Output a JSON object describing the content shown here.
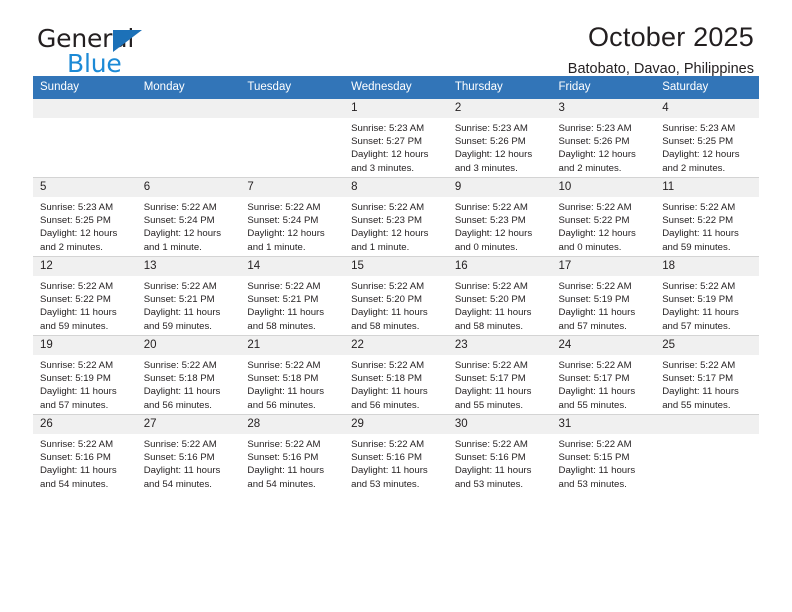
{
  "brand": {
    "name_top": "General",
    "name_bottom": "Blue",
    "triangle_color": "#1c71b8",
    "blue_text_color": "#1c8ad6"
  },
  "header": {
    "title": "October 2025",
    "subtitle": "Batobato, Davao, Philippines",
    "accent_color": "#3275b8",
    "daynum_band_color": "#f0f0f0"
  },
  "weekdays": [
    "Sunday",
    "Monday",
    "Tuesday",
    "Wednesday",
    "Thursday",
    "Friday",
    "Saturday"
  ],
  "labels": {
    "sunrise": "Sunrise:",
    "sunset": "Sunset:",
    "daylight": "Daylight:"
  },
  "weeks": [
    [
      {
        "day": "",
        "empty": true
      },
      {
        "day": "",
        "empty": true
      },
      {
        "day": "",
        "empty": true
      },
      {
        "day": "1",
        "sunrise": "Sunrise: 5:23 AM",
        "sunset": "Sunset: 5:27 PM",
        "daylight1": "Daylight: 12 hours",
        "daylight2": "and 3 minutes."
      },
      {
        "day": "2",
        "sunrise": "Sunrise: 5:23 AM",
        "sunset": "Sunset: 5:26 PM",
        "daylight1": "Daylight: 12 hours",
        "daylight2": "and 3 minutes."
      },
      {
        "day": "3",
        "sunrise": "Sunrise: 5:23 AM",
        "sunset": "Sunset: 5:26 PM",
        "daylight1": "Daylight: 12 hours",
        "daylight2": "and 2 minutes."
      },
      {
        "day": "4",
        "sunrise": "Sunrise: 5:23 AM",
        "sunset": "Sunset: 5:25 PM",
        "daylight1": "Daylight: 12 hours",
        "daylight2": "and 2 minutes."
      }
    ],
    [
      {
        "day": "5",
        "sunrise": "Sunrise: 5:23 AM",
        "sunset": "Sunset: 5:25 PM",
        "daylight1": "Daylight: 12 hours",
        "daylight2": "and 2 minutes."
      },
      {
        "day": "6",
        "sunrise": "Sunrise: 5:22 AM",
        "sunset": "Sunset: 5:24 PM",
        "daylight1": "Daylight: 12 hours",
        "daylight2": "and 1 minute."
      },
      {
        "day": "7",
        "sunrise": "Sunrise: 5:22 AM",
        "sunset": "Sunset: 5:24 PM",
        "daylight1": "Daylight: 12 hours",
        "daylight2": "and 1 minute."
      },
      {
        "day": "8",
        "sunrise": "Sunrise: 5:22 AM",
        "sunset": "Sunset: 5:23 PM",
        "daylight1": "Daylight: 12 hours",
        "daylight2": "and 1 minute."
      },
      {
        "day": "9",
        "sunrise": "Sunrise: 5:22 AM",
        "sunset": "Sunset: 5:23 PM",
        "daylight1": "Daylight: 12 hours",
        "daylight2": "and 0 minutes."
      },
      {
        "day": "10",
        "sunrise": "Sunrise: 5:22 AM",
        "sunset": "Sunset: 5:22 PM",
        "daylight1": "Daylight: 12 hours",
        "daylight2": "and 0 minutes."
      },
      {
        "day": "11",
        "sunrise": "Sunrise: 5:22 AM",
        "sunset": "Sunset: 5:22 PM",
        "daylight1": "Daylight: 11 hours",
        "daylight2": "and 59 minutes."
      }
    ],
    [
      {
        "day": "12",
        "sunrise": "Sunrise: 5:22 AM",
        "sunset": "Sunset: 5:22 PM",
        "daylight1": "Daylight: 11 hours",
        "daylight2": "and 59 minutes."
      },
      {
        "day": "13",
        "sunrise": "Sunrise: 5:22 AM",
        "sunset": "Sunset: 5:21 PM",
        "daylight1": "Daylight: 11 hours",
        "daylight2": "and 59 minutes."
      },
      {
        "day": "14",
        "sunrise": "Sunrise: 5:22 AM",
        "sunset": "Sunset: 5:21 PM",
        "daylight1": "Daylight: 11 hours",
        "daylight2": "and 58 minutes."
      },
      {
        "day": "15",
        "sunrise": "Sunrise: 5:22 AM",
        "sunset": "Sunset: 5:20 PM",
        "daylight1": "Daylight: 11 hours",
        "daylight2": "and 58 minutes."
      },
      {
        "day": "16",
        "sunrise": "Sunrise: 5:22 AM",
        "sunset": "Sunset: 5:20 PM",
        "daylight1": "Daylight: 11 hours",
        "daylight2": "and 58 minutes."
      },
      {
        "day": "17",
        "sunrise": "Sunrise: 5:22 AM",
        "sunset": "Sunset: 5:19 PM",
        "daylight1": "Daylight: 11 hours",
        "daylight2": "and 57 minutes."
      },
      {
        "day": "18",
        "sunrise": "Sunrise: 5:22 AM",
        "sunset": "Sunset: 5:19 PM",
        "daylight1": "Daylight: 11 hours",
        "daylight2": "and 57 minutes."
      }
    ],
    [
      {
        "day": "19",
        "sunrise": "Sunrise: 5:22 AM",
        "sunset": "Sunset: 5:19 PM",
        "daylight1": "Daylight: 11 hours",
        "daylight2": "and 57 minutes."
      },
      {
        "day": "20",
        "sunrise": "Sunrise: 5:22 AM",
        "sunset": "Sunset: 5:18 PM",
        "daylight1": "Daylight: 11 hours",
        "daylight2": "and 56 minutes."
      },
      {
        "day": "21",
        "sunrise": "Sunrise: 5:22 AM",
        "sunset": "Sunset: 5:18 PM",
        "daylight1": "Daylight: 11 hours",
        "daylight2": "and 56 minutes."
      },
      {
        "day": "22",
        "sunrise": "Sunrise: 5:22 AM",
        "sunset": "Sunset: 5:18 PM",
        "daylight1": "Daylight: 11 hours",
        "daylight2": "and 56 minutes."
      },
      {
        "day": "23",
        "sunrise": "Sunrise: 5:22 AM",
        "sunset": "Sunset: 5:17 PM",
        "daylight1": "Daylight: 11 hours",
        "daylight2": "and 55 minutes."
      },
      {
        "day": "24",
        "sunrise": "Sunrise: 5:22 AM",
        "sunset": "Sunset: 5:17 PM",
        "daylight1": "Daylight: 11 hours",
        "daylight2": "and 55 minutes."
      },
      {
        "day": "25",
        "sunrise": "Sunrise: 5:22 AM",
        "sunset": "Sunset: 5:17 PM",
        "daylight1": "Daylight: 11 hours",
        "daylight2": "and 55 minutes."
      }
    ],
    [
      {
        "day": "26",
        "sunrise": "Sunrise: 5:22 AM",
        "sunset": "Sunset: 5:16 PM",
        "daylight1": "Daylight: 11 hours",
        "daylight2": "and 54 minutes."
      },
      {
        "day": "27",
        "sunrise": "Sunrise: 5:22 AM",
        "sunset": "Sunset: 5:16 PM",
        "daylight1": "Daylight: 11 hours",
        "daylight2": "and 54 minutes."
      },
      {
        "day": "28",
        "sunrise": "Sunrise: 5:22 AM",
        "sunset": "Sunset: 5:16 PM",
        "daylight1": "Daylight: 11 hours",
        "daylight2": "and 54 minutes."
      },
      {
        "day": "29",
        "sunrise": "Sunrise: 5:22 AM",
        "sunset": "Sunset: 5:16 PM",
        "daylight1": "Daylight: 11 hours",
        "daylight2": "and 53 minutes."
      },
      {
        "day": "30",
        "sunrise": "Sunrise: 5:22 AM",
        "sunset": "Sunset: 5:16 PM",
        "daylight1": "Daylight: 11 hours",
        "daylight2": "and 53 minutes."
      },
      {
        "day": "31",
        "sunrise": "Sunrise: 5:22 AM",
        "sunset": "Sunset: 5:15 PM",
        "daylight1": "Daylight: 11 hours",
        "daylight2": "and 53 minutes."
      },
      {
        "day": "",
        "empty": true
      }
    ]
  ]
}
